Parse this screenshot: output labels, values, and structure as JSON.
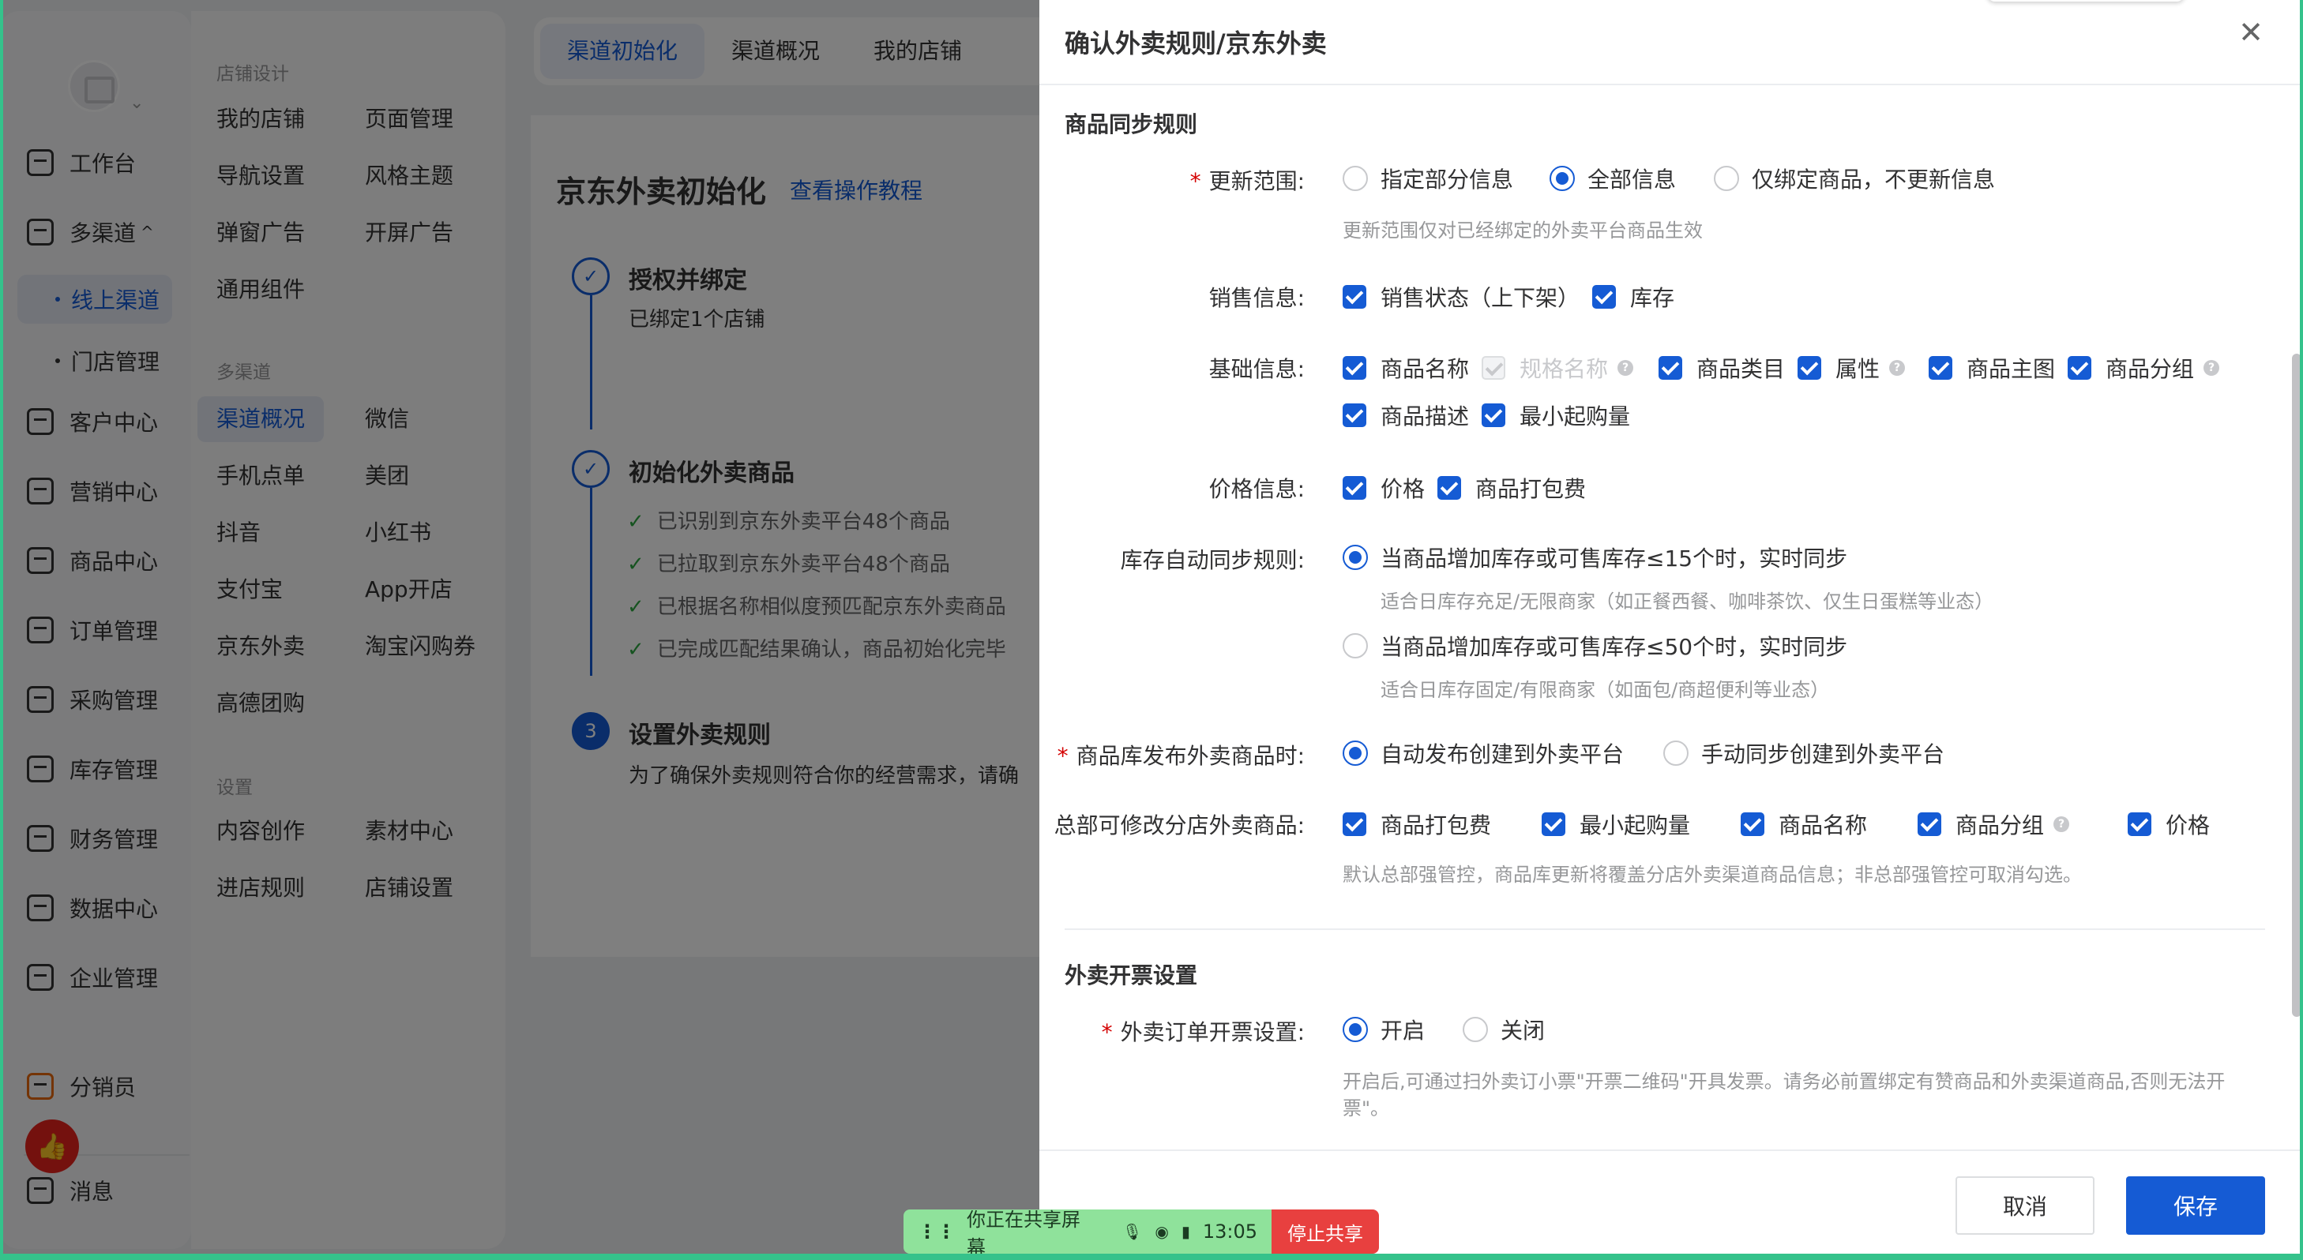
{
  "sidebar_primary": {
    "items": [
      {
        "label": "工作台",
        "icon": "dashboard-icon"
      },
      {
        "label": "多渠道",
        "icon": "channel-icon",
        "expanded": true
      },
      {
        "label": "线上渠道",
        "sub": true,
        "active": true
      },
      {
        "label": "门店管理",
        "sub": true
      },
      {
        "label": "客户中心",
        "icon": "user-icon"
      },
      {
        "label": "营销中心",
        "icon": "marketing-icon"
      },
      {
        "label": "商品中心",
        "icon": "bag-icon"
      },
      {
        "label": "订单管理",
        "icon": "order-icon"
      },
      {
        "label": "采购管理",
        "icon": "cart-icon"
      },
      {
        "label": "库存管理",
        "icon": "warehouse-icon"
      },
      {
        "label": "财务管理",
        "icon": "finance-icon"
      },
      {
        "label": "数据中心",
        "icon": "chart-icon"
      },
      {
        "label": "企业管理",
        "icon": "building-icon"
      }
    ],
    "distributor": "分销员",
    "messages": "消息"
  },
  "sidebar_secondary": {
    "groups": [
      {
        "title": "店铺设计",
        "links": [
          "我的店铺",
          "页面管理",
          "导航设置",
          "风格主题",
          "弹窗广告",
          "开屏广告",
          "通用组件"
        ]
      },
      {
        "title": "多渠道",
        "links": [
          "渠道概况",
          "微信",
          "手机点单",
          "美团",
          "抖音",
          "小红书",
          "支付宝",
          "App开店",
          "京东外卖",
          "淘宝闪购券",
          "高德团购"
        ]
      },
      {
        "title": "设置",
        "links": [
          "内容创作",
          "素材中心",
          "进店规则",
          "店铺设置"
        ]
      }
    ]
  },
  "main": {
    "tabs": [
      "渠道初始化",
      "渠道概况",
      "我的店铺"
    ],
    "title": "京东外卖初始化",
    "tutorial_link": "查看操作教程",
    "steps": [
      {
        "title": "授权并绑定",
        "desc": "已绑定1个店铺"
      },
      {
        "title": "初始化外卖商品",
        "checks": [
          "已识别到京东外卖平台48个商品",
          "已拉取到京东外卖平台48个商品",
          "已根据名称相似度预匹配京东外卖商品",
          "已完成匹配结果确认，商品初始化完毕"
        ]
      },
      {
        "number": "3",
        "title": "设置外卖规则",
        "desc": "为了确保外卖规则符合你的经营需求，请确"
      }
    ]
  },
  "drawer": {
    "title": "确认外卖规则/京东外卖",
    "section_sync": "商品同步规则",
    "update_scope": {
      "label": "更新范围:",
      "options": [
        "指定部分信息",
        "全部信息",
        "仅绑定商品，不更新信息"
      ],
      "selected": "全部信息",
      "hint": "更新范围仅对已经绑定的外卖平台商品生效"
    },
    "sales_info": {
      "label": "销售信息:",
      "options": [
        "销售状态（上下架）",
        "库存"
      ]
    },
    "basic_info": {
      "label": "基础信息:",
      "options": [
        "商品名称",
        "规格名称",
        "商品类目",
        "属性",
        "商品主图",
        "商品分组",
        "商品描述",
        "最小起购量"
      ],
      "disabled": [
        "规格名称"
      ]
    },
    "price_info": {
      "label": "价格信息:",
      "options": [
        "价格",
        "商品打包费"
      ]
    },
    "stock_rule": {
      "label": "库存自动同步规则:",
      "options": [
        {
          "label": "当商品增加库存或可售库存≤15个时，实时同步",
          "hint": "适合日库存充足/无限商家（如正餐西餐、咖啡茶饮、仅生日蛋糕等业态）"
        },
        {
          "label": "当商品增加库存或可售库存≤50个时，实时同步",
          "hint": "适合日库存固定/有限商家（如面包/商超便利等业态）"
        }
      ],
      "selected_index": 0
    },
    "publish": {
      "label": "商品库发布外卖商品时:",
      "options": [
        "自动发布创建到外卖平台",
        "手动同步创建到外卖平台"
      ],
      "selected": "自动发布创建到外卖平台"
    },
    "hq_modify": {
      "label": "总部可修改分店外卖商品:",
      "options": [
        "商品打包费",
        "最小起购量",
        "商品名称",
        "商品分组",
        "价格"
      ],
      "hint": "默认总部强管控，商品库更新将覆盖分店外卖渠道商品信息；非总部强管控可取消勾选。"
    },
    "section_invoice": "外卖开票设置",
    "invoice": {
      "label": "外卖订单开票设置:",
      "options": [
        "开启",
        "关闭"
      ],
      "selected": "开启",
      "hint_line1": "开启后,可通过扫外卖订小票\"开票二维码\"开具发票。请务必前置绑定有赞商品和外卖渠道商品,否则无法开",
      "hint_line2": "票\"。"
    },
    "cancel": "取消",
    "save": "保存"
  },
  "share_bar": {
    "text": "你正在共享屏幕",
    "time": "13:05",
    "stop": "停止共享"
  },
  "colors": {
    "primary": "#155bd4",
    "danger": "#d40000",
    "success": "#2da641",
    "share_green": "#8fe29b",
    "share_red": "#e8403f"
  }
}
